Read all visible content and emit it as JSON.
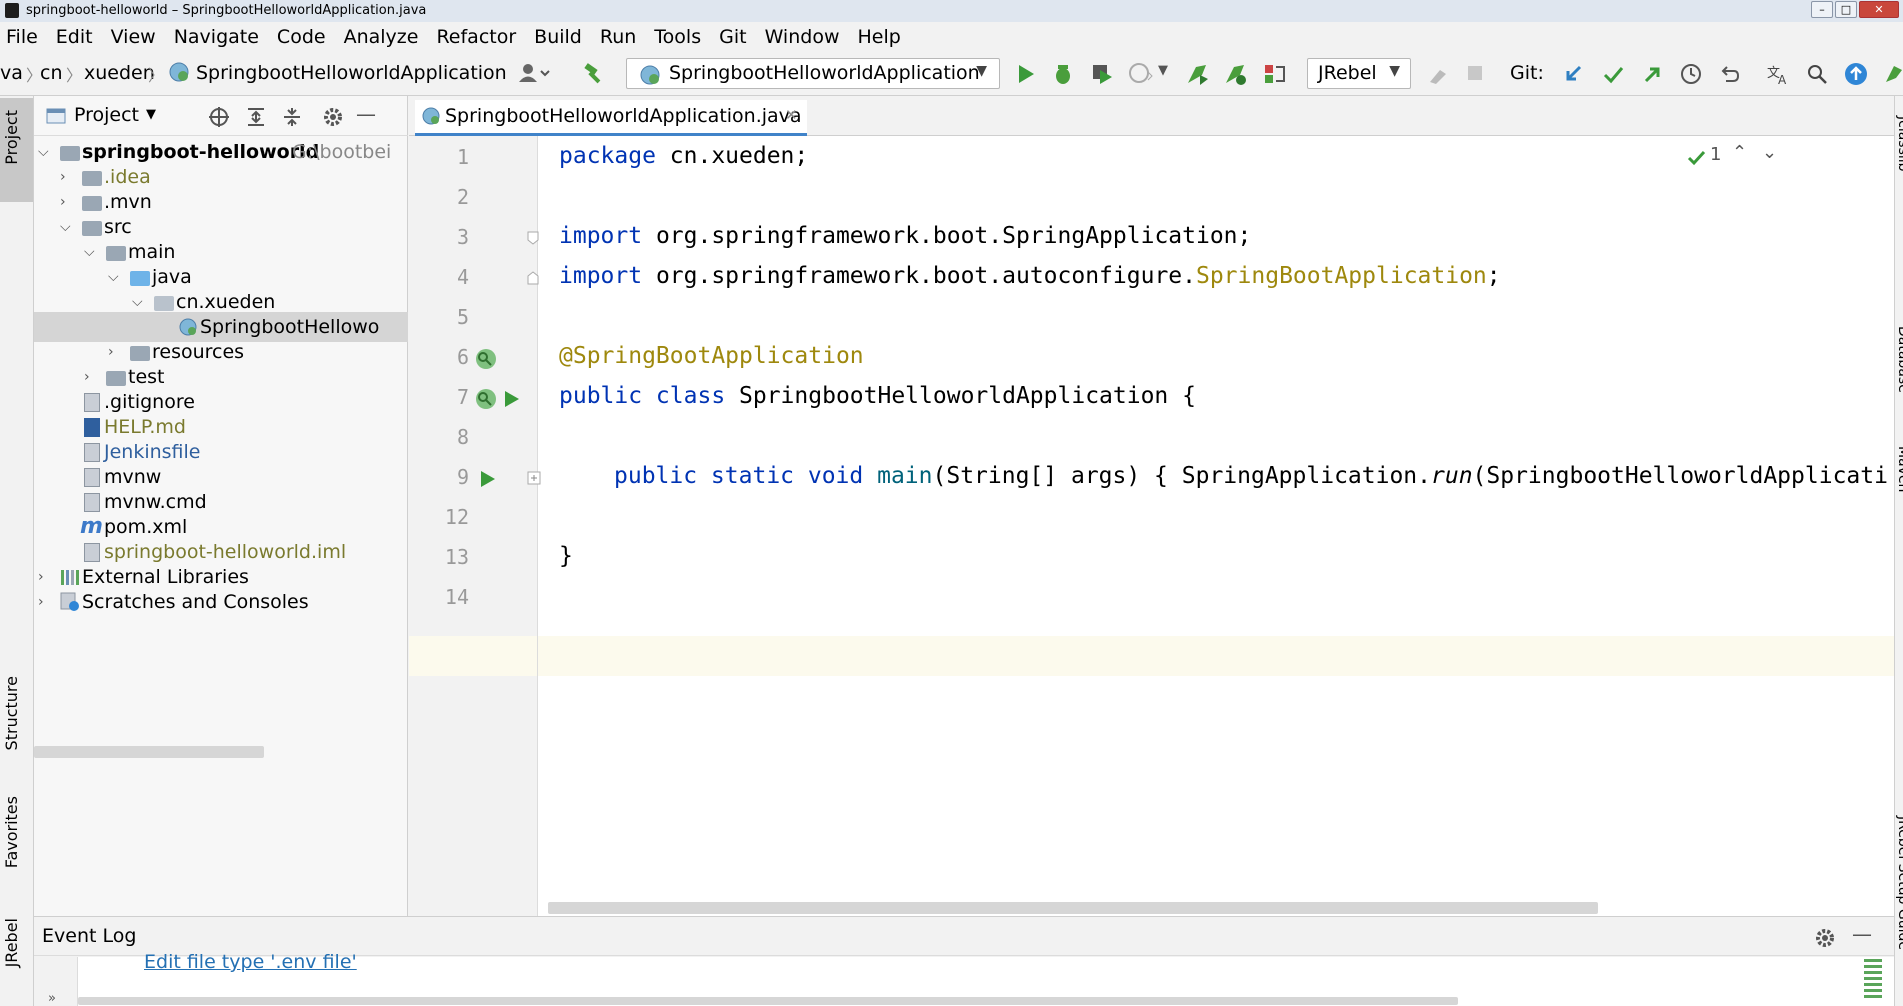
{
  "window": {
    "title": "springboot-helloworld – SpringbootHelloworldApplication.java"
  },
  "menu": [
    "File",
    "Edit",
    "View",
    "Navigate",
    "Code",
    "Analyze",
    "Refactor",
    "Build",
    "Run",
    "Tools",
    "Git",
    "Window",
    "Help"
  ],
  "breadcrumb": [
    "va",
    "cn",
    "xueden",
    "SpringbootHelloworldApplication"
  ],
  "toolbar": {
    "run_config": "SpringbootHelloworldApplication",
    "jrebel": "JRebel",
    "git_label": "Git:"
  },
  "left_tabs": [
    "Project",
    "Structure",
    "Favorites",
    "JRebel"
  ],
  "right_tabs": [
    "Jclasslib",
    "Database",
    "Maven",
    "JRebel Setup Guide"
  ],
  "project": {
    "title": "Project",
    "tree": [
      {
        "label": "springboot-helloworld",
        "suffix": "G:\\bootbei",
        "bold": true
      },
      {
        "label": ".idea"
      },
      {
        "label": ".mvn"
      },
      {
        "label": "src"
      },
      {
        "label": "main"
      },
      {
        "label": "java"
      },
      {
        "label": "cn.xueden"
      },
      {
        "label": "SpringbootHellowo"
      },
      {
        "label": "resources"
      },
      {
        "label": "test"
      },
      {
        "label": ".gitignore"
      },
      {
        "label": "HELP.md"
      },
      {
        "label": "Jenkinsfile"
      },
      {
        "label": "mvnw"
      },
      {
        "label": "mvnw.cmd"
      },
      {
        "label": "pom.xml"
      },
      {
        "label": "springboot-helloworld.iml"
      },
      {
        "label": "External Libraries"
      },
      {
        "label": "Scratches and Consoles"
      }
    ]
  },
  "editor": {
    "tab": "SpringbootHelloworldApplication.java",
    "inspection_count": "1",
    "line_numbers": [
      "1",
      "2",
      "3",
      "4",
      "5",
      "6",
      "7",
      "8",
      "9",
      "12",
      "13",
      "14"
    ],
    "code": {
      "l1_kw": "package",
      "l1_rest": " cn.xueden;",
      "l3_kw": "import",
      "l3_rest": " org.springframework.boot.SpringApplication;",
      "l4_kw": "import",
      "l4_rest": " org.springframework.boot.autoconfigure.",
      "l4_ann": "SpringBootApplication",
      "l4_end": ";",
      "l6_ann": "@SpringBootApplication",
      "l7_kw": "public class",
      "l7_rest": " SpringbootHelloworldApplication {",
      "l9_kw": "public static void",
      "l9_main": " main",
      "l9_rest": "(String[] args) { SpringApplication.",
      "l9_run": "run",
      "l9_end": "(SpringbootHelloworldApplicati",
      "l13": "}"
    }
  },
  "event_log": {
    "title": "Event Log",
    "link": "Edit file type '.env file'"
  },
  "colors": {
    "keyword": "#0033b3",
    "annotation": "#9e880d",
    "run_green": "#3a9a3a",
    "selection": "#d5d5d5"
  }
}
